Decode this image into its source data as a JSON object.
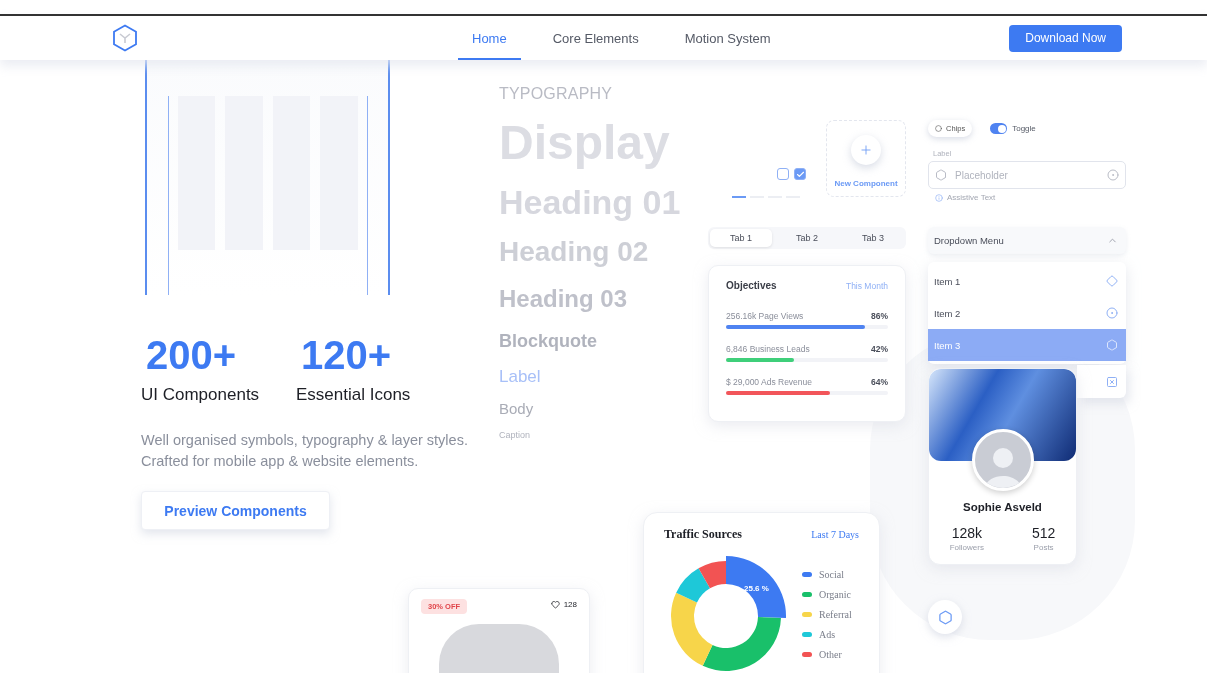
{
  "header": {
    "nav": [
      {
        "label": "Home",
        "selected": true
      },
      {
        "label": "Core Elements",
        "selected": false
      },
      {
        "label": "Motion System",
        "selected": false
      }
    ],
    "cta": "Download Now"
  },
  "hero": {
    "stats": [
      {
        "value": "200+",
        "label": "UI Components"
      },
      {
        "value": "120+",
        "label": "Essential Icons"
      }
    ],
    "description": [
      "Well organised symbols, typography & layer styles.",
      "Crafted for mobile app & website elements."
    ],
    "button": "Preview Components"
  },
  "typography": {
    "heading": "TYPOGRAPHY",
    "samples": [
      {
        "kind": "display",
        "text": "Display"
      },
      {
        "kind": "h1",
        "text": "Heading 01"
      },
      {
        "kind": "h2",
        "text": "Heading 02"
      },
      {
        "kind": "h3",
        "text": "Heading 03"
      },
      {
        "kind": "blockquote",
        "text": "Blockquote"
      },
      {
        "kind": "label",
        "text": "Label"
      },
      {
        "kind": "body",
        "text": "Body"
      },
      {
        "kind": "caption",
        "text": "Caption"
      }
    ]
  },
  "checkboxes": [
    {
      "checked": false
    },
    {
      "checked": true
    }
  ],
  "pager": [
    {
      "selected": true
    },
    {
      "selected": false
    },
    {
      "selected": false
    },
    {
      "selected": false
    }
  ],
  "new_component": {
    "label": "New Component"
  },
  "segmented_tabs": [
    {
      "label": "Tab 1",
      "selected": true
    },
    {
      "label": "Tab 2",
      "selected": false
    },
    {
      "label": "Tab 3",
      "selected": false
    }
  ],
  "objectives": {
    "title": "Objectives",
    "period": "This Month",
    "rows": [
      {
        "label": "256.16k Page Views",
        "reading": "86%",
        "level": 0.86,
        "color": "#4f83f1"
      },
      {
        "label": "6,846 Business Leads",
        "reading": "42%",
        "level": 0.42,
        "color": "#3fcf7a"
      },
      {
        "label": "$ 29,000 Ads Revenue",
        "reading": "64%",
        "level": 0.64,
        "color": "#f2555a"
      }
    ]
  },
  "chip": {
    "label": "Chips"
  },
  "toggle": {
    "label": "Toggle",
    "on": true
  },
  "field": {
    "label": "Label",
    "placeholder": "Placeholder",
    "assistive": "Assistive Text"
  },
  "dropdown": {
    "label": "Dropdown Menu",
    "expanded": true,
    "items": [
      {
        "label": "Item 1",
        "selected": false
      },
      {
        "label": "Item 2",
        "selected": false
      },
      {
        "label": "Item 3",
        "selected": true
      }
    ]
  },
  "profile": {
    "name": "Sophie Asveld",
    "stats": [
      {
        "value": "128k",
        "label": "Followers"
      },
      {
        "value": "512",
        "label": "Posts"
      }
    ]
  },
  "traffic": {
    "title": "Traffic Sources",
    "period": "Last 7 Days",
    "slice_label": "25.6 %",
    "legend": [
      {
        "label": "Social",
        "color": "#3d7af2"
      },
      {
        "label": "Organic",
        "color": "#19c06a"
      },
      {
        "label": "Referral",
        "color": "#f7d54a"
      },
      {
        "label": "Ads",
        "color": "#1ec8d8"
      },
      {
        "label": "Other",
        "color": "#f25353"
      }
    ]
  },
  "product": {
    "badge": "30% OFF",
    "likes": "128"
  }
}
